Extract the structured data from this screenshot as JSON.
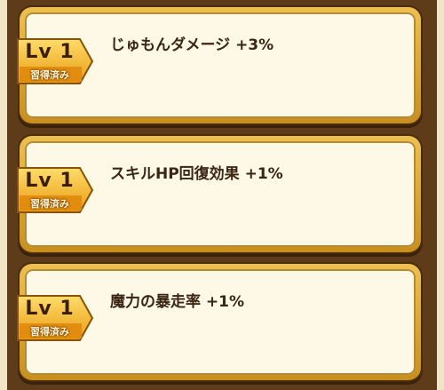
{
  "skills": [
    {
      "level": "Lv 1",
      "status": "習得済み",
      "name": "じゅもんダメージ +3%"
    },
    {
      "level": "Lv 1",
      "status": "習得済み",
      "name": "スキルHP回復効果 +1%"
    },
    {
      "level": "Lv 1",
      "status": "習得済み",
      "name": "魔力の暴走率 +1%"
    }
  ],
  "colors": {
    "panel": "#5e3c1a",
    "card_border": "#e1aa33",
    "card_fill": "#fdf9e6",
    "badge": "#f4b72a",
    "text": "#3b2513"
  }
}
